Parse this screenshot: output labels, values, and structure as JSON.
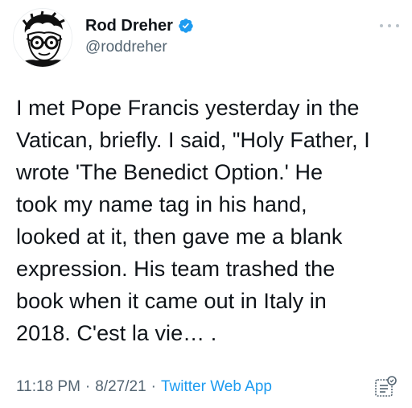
{
  "user": {
    "display_name": "Rod Dreher",
    "handle": "@roddreher",
    "verified": true
  },
  "icons": {
    "verified": "verified-badge-icon",
    "more": "more-horizontal-icon",
    "analytics": "tweet-analytics-icon"
  },
  "colors": {
    "accent": "#1d9bf0",
    "secondary_text": "#536471",
    "primary_text": "#0f1419"
  },
  "tweet": {
    "text": "I met Pope Francis yesterday in the\nVatican, briefly. I said, \"Holy Father, I\nwrote 'The Benedict Option.' He\ntook my name tag in his hand,\nlooked at it, then gave me a blank\nexpression. His team trashed the\nbook when it came out in Italy in\n2018. C'est la vie… ."
  },
  "meta": {
    "time": "11:18 PM",
    "separator": "·",
    "date": "8/27/21",
    "source": "Twitter Web App"
  }
}
